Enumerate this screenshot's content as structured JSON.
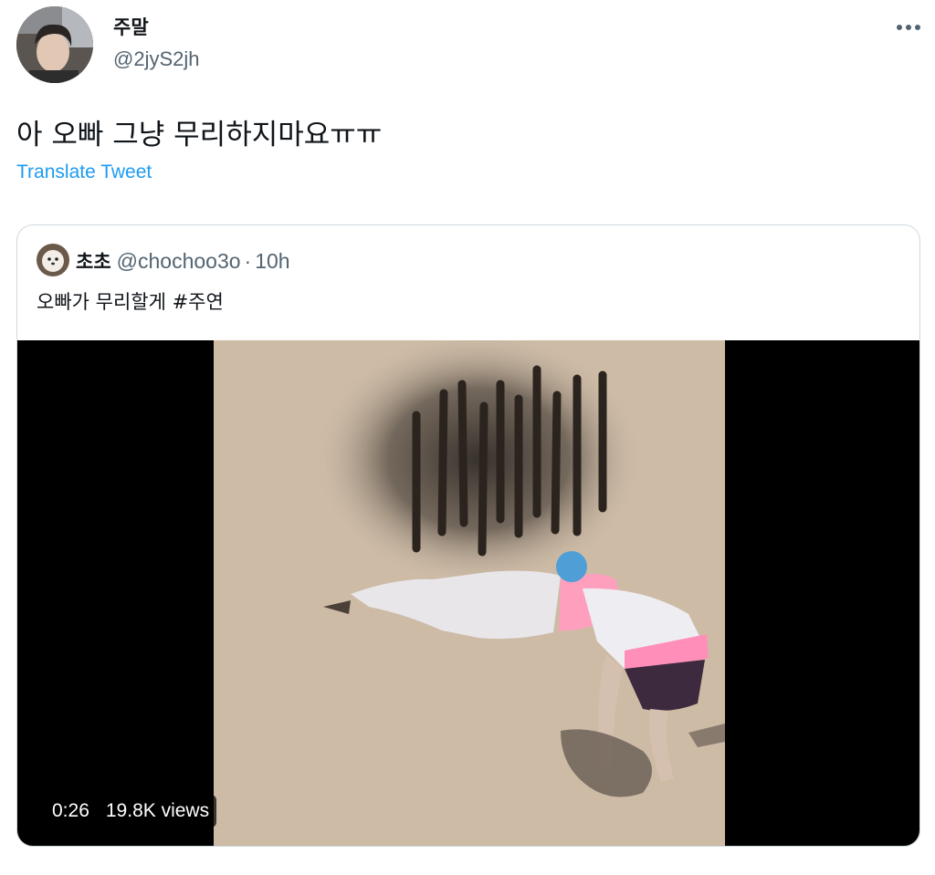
{
  "tweet": {
    "author_name": "주말",
    "author_handle": "@2jyS2jh",
    "text": "아 오빠 그냥 무리하지마요ㅠㅠ",
    "translate_label": "Translate Tweet"
  },
  "quoted_tweet": {
    "author_name": "초초",
    "author_handle": "@chochoo3o",
    "separator": "·",
    "time": "10h",
    "text": "오빠가 무리할게 #주연",
    "video": {
      "duration": "0:26",
      "views": "19.8K views"
    }
  },
  "colors": {
    "accent": "#1d9bf0",
    "secondary_text": "#536471",
    "border": "#cfd9de",
    "video_bg": "#000000",
    "sand": "#cdbba6"
  },
  "icons": {
    "more": "more-horizontal-icon"
  }
}
